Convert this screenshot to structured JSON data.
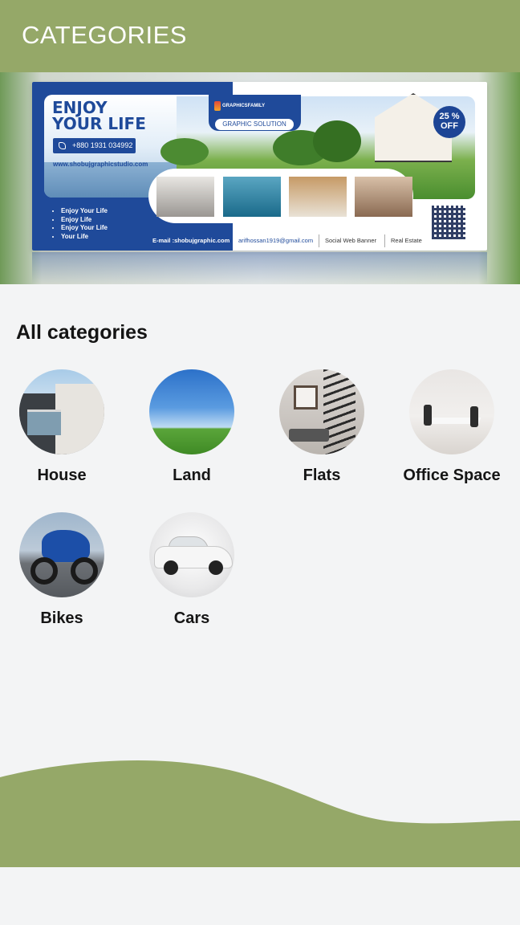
{
  "appbar": {
    "title": "CATEGORIES",
    "color": "#95a868"
  },
  "banner": {
    "headline_line1": "ENJOY",
    "headline_line2": "YOUR LIFE",
    "phone": "+880 1931 034992",
    "website": "www.shobujgraphicstudio.com",
    "bullets": [
      "Enjoy Your Life",
      "Enjoy Life",
      "Enjoy Your Life",
      "Your Life"
    ],
    "brand": "GRAPHICSFAMILY",
    "tagline": "GRAPHIC SOLUTION",
    "badge_line1": "25 %",
    "badge_line2": "OFF",
    "email": "E-mail :shobujgraphic.com",
    "email2": "arifhossan1919@gmail.com",
    "tag1": "Social Web Banner",
    "tag2": "Real Estate",
    "brand_blue": "#1f4a9a"
  },
  "section": {
    "title": "All categories"
  },
  "categories": [
    {
      "label": "House",
      "icon": "house-photo"
    },
    {
      "label": "Land",
      "icon": "land-photo"
    },
    {
      "label": "Flats",
      "icon": "flats-photo"
    },
    {
      "label": "Office Space",
      "icon": "office-photo"
    },
    {
      "label": "Bikes",
      "icon": "bike-photo"
    },
    {
      "label": "Cars",
      "icon": "car-photo"
    }
  ]
}
